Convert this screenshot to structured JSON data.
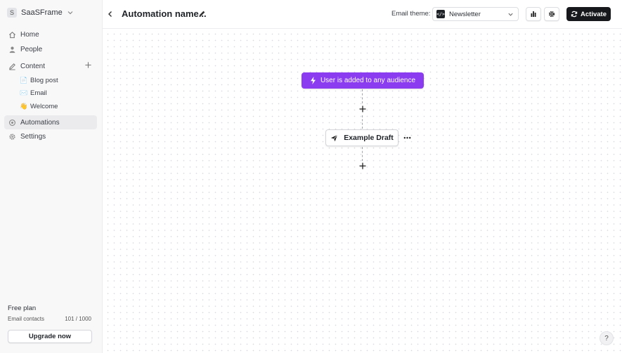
{
  "sidebar": {
    "workspace_initial": "S",
    "workspace_name": "SaaSFrame",
    "nav": {
      "home": "Home",
      "people": "People",
      "content": "Content",
      "automations": "Automations",
      "settings": "Settings"
    },
    "content_items": [
      {
        "emoji": "📄",
        "label": "Blog post"
      },
      {
        "emoji": "✉️",
        "label": "Email"
      },
      {
        "emoji": "👋",
        "label": "Welcome"
      }
    ],
    "plan": "Free plan",
    "contacts_label": "Email contacts",
    "contacts_count": "101 / 1000",
    "upgrade_label": "Upgrade now"
  },
  "header": {
    "title": "Automation name...",
    "theme_label": "Email theme:",
    "theme_value": "Newsletter",
    "activate_label": "Activate"
  },
  "flow": {
    "trigger_label": "User is added to any audience",
    "step_label": "Example Draft"
  },
  "help_label": "?",
  "colors": {
    "trigger": "#8b3cf0",
    "activate": "#16181b",
    "sidebar_bg": "#f8f8f9"
  }
}
